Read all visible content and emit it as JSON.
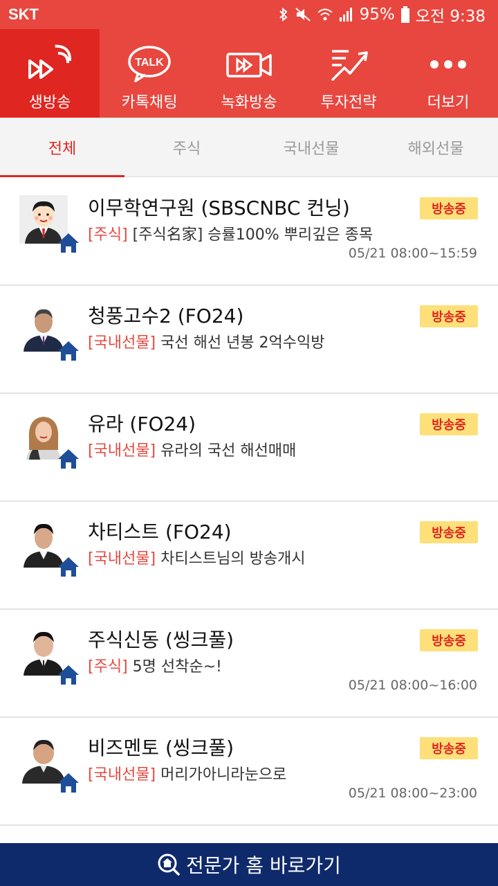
{
  "status_bar": {
    "carrier": "SKT",
    "battery": "95%",
    "clock": "오전 9:38"
  },
  "nav": [
    {
      "label": "생방송",
      "icon": "live-broadcast-icon"
    },
    {
      "label": "카톡채팅",
      "icon": "talk-bubble-icon",
      "icon_text": "TALK"
    },
    {
      "label": "녹화방송",
      "icon": "recorded-video-icon"
    },
    {
      "label": "투자전략",
      "icon": "trend-chart-icon"
    },
    {
      "label": "더보기",
      "icon": "more-dots-icon"
    }
  ],
  "tabs": [
    "전체",
    "주식",
    "국내선물",
    "해외선물"
  ],
  "broadcasts": [
    {
      "title": "이무학연구원 (SBSCNBC 컨닝)",
      "category": "[주식]",
      "desc": "[주식名家] 승률100% 뿌리깊은 종목",
      "time": "05/21 08:00~15:59",
      "badge": "방송중"
    },
    {
      "title": "청풍고수2 (FO24)",
      "category": "[국내선물]",
      "desc": "국선 해선 년봉 2억수익방",
      "time": "",
      "badge": "방송중"
    },
    {
      "title": "유라 (FO24)",
      "category": "[국내선물]",
      "desc": "유라의 국선 해선매매",
      "time": "",
      "badge": "방송중"
    },
    {
      "title": "차티스트 (FO24)",
      "category": "[국내선물]",
      "desc": "차티스트님의 방송개시",
      "time": "",
      "badge": "방송중"
    },
    {
      "title": "주식신동 (씽크풀)",
      "category": "[주식]",
      "desc": "5명 선착순~!",
      "time": "05/21 08:00~16:00",
      "badge": "방송중"
    },
    {
      "title": "비즈멘토 (씽크풀)",
      "category": "[국내선물]",
      "desc": "머리가아니라눈으로",
      "time": "05/21 08:00~23:00",
      "badge": "방송중"
    }
  ],
  "bottom_button": {
    "label": "전문가 홈 바로가기",
    "icon": "home-search-icon"
  },
  "colors": {
    "brand_red": "#e8473f",
    "active_red": "#e02620",
    "badge_yellow": "#fde07a",
    "bottom_navy": "#0f2a6b"
  }
}
